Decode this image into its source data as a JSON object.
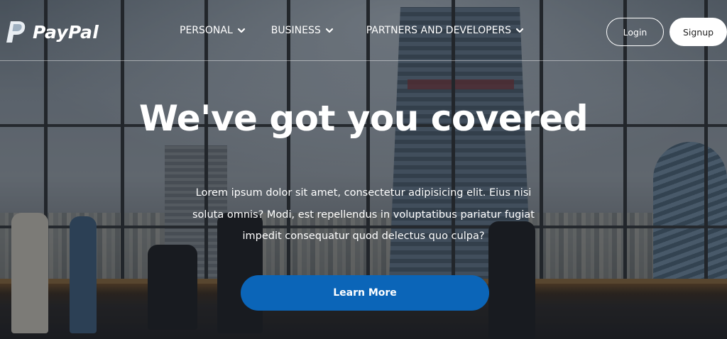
{
  "brand": {
    "name": "PayPal",
    "logo_icon": "paypal-p-logo"
  },
  "nav": {
    "items": [
      {
        "label": "PERSONAL",
        "icon": "chevron-down-icon"
      },
      {
        "label": "BUSINESS",
        "icon": "chevron-down-icon"
      },
      {
        "label": "PARTNERS AND DEVELOPERS",
        "icon": "chevron-down-icon"
      }
    ],
    "login_label": "Login",
    "signup_label": "Signup"
  },
  "hero": {
    "headline": "We've got you covered",
    "body": "Lorem ipsum dolor sit amet, consectetur adipisicing elit. Eius nisi soluta omnis? Modi, est repellendus in voluptatibus pariatur fugiat impedit consequatur quod delectus quo culpa?",
    "cta_label": "Learn More"
  },
  "colors": {
    "cta_background": "#0b65b8",
    "text": "#ffffff",
    "signup_background": "#ffffff"
  }
}
